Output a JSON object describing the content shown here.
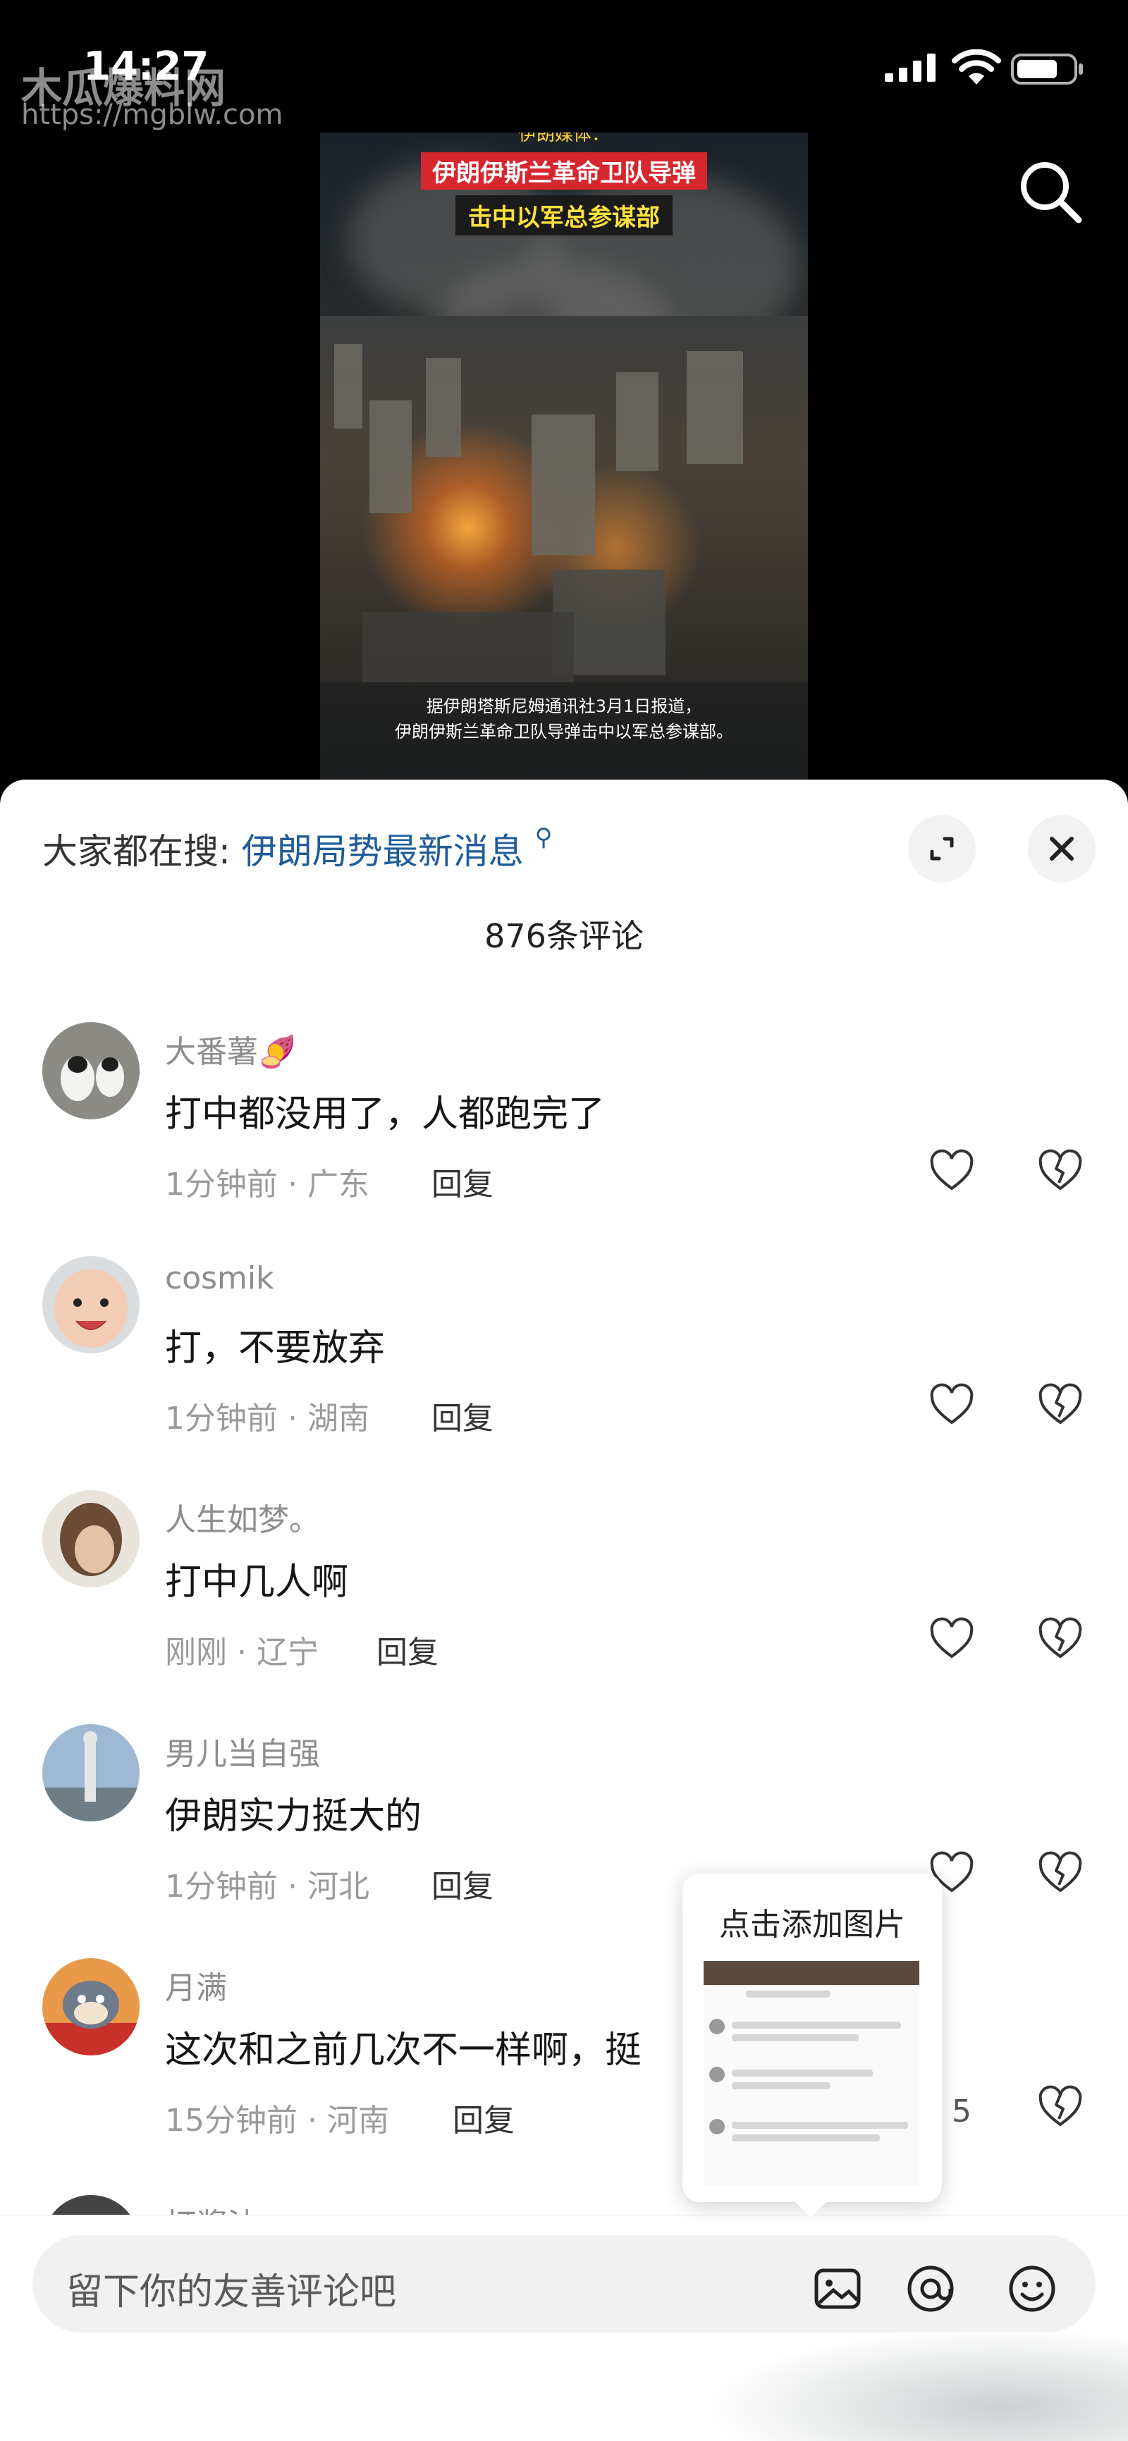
{
  "status_bar": {
    "time": "14:27"
  },
  "watermark": {
    "name": "木瓜爆料网",
    "url": "https://mgblw.com"
  },
  "video": {
    "caption_top_small": "伊朗媒体：",
    "caption_line1": "伊朗伊斯兰革命卫队导弹",
    "caption_line2": "击中以军总参谋部",
    "subtitle_line1": "据伊朗塔斯尼姆通讯社3月1日报道，",
    "subtitle_line2": "伊朗伊斯兰革命卫队导弹击中以军总参谋部。"
  },
  "sheet": {
    "search_prefix": "大家都在搜:",
    "search_keyword": "伊朗局势最新消息",
    "comment_count": "876条评论"
  },
  "comments": [
    {
      "username": "大番薯🍠",
      "text": "打中都没用了，人都跑完了",
      "meta": "1分钟前 · 广东",
      "reply": "回复"
    },
    {
      "username": "cosmik",
      "text": "打，不要放弃",
      "meta": "1分钟前 · 湖南",
      "reply": "回复"
    },
    {
      "username": "人生如梦。",
      "text": "打中几人啊",
      "meta": "刚刚 · 辽宁",
      "reply": "回复"
    },
    {
      "username": "男儿当自强",
      "text": "伊朗实力挺大的",
      "meta": "1分钟前 · 河北",
      "reply": "回复"
    },
    {
      "username": "月满",
      "text": "这次和之前几次不一样啊，挺",
      "meta": "15分钟前 · 河南",
      "reply": "回复",
      "likes": "5"
    }
  ],
  "partial_comment": {
    "username": "打酱油"
  },
  "input_bar": {
    "placeholder": "留下你的友善评论吧"
  },
  "tooltip": {
    "title": "点击添加图片"
  },
  "colors": {
    "accent_link": "#1f5c99",
    "video_red": "#d6262e",
    "video_yellow": "#ffe23d"
  }
}
